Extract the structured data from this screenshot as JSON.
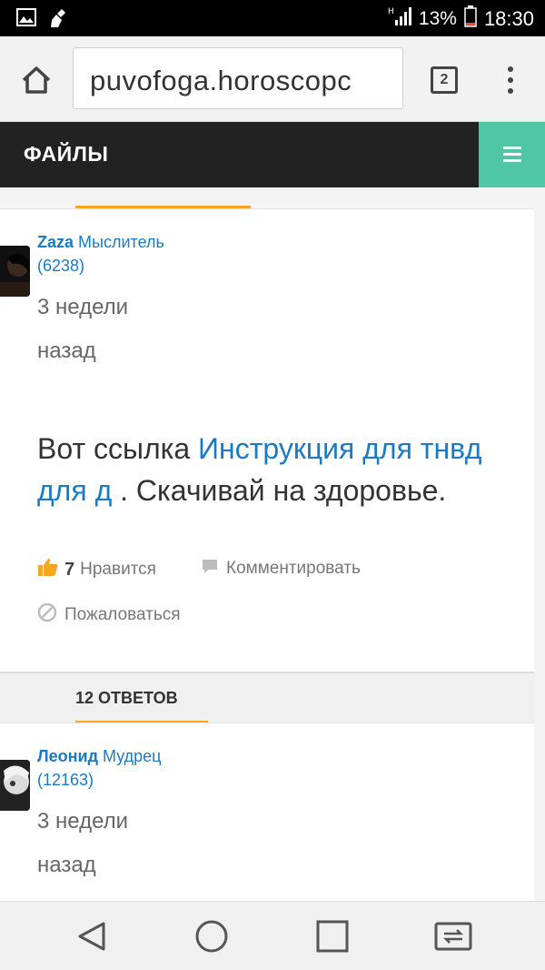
{
  "status_bar": {
    "signal_label": "H",
    "battery": "13%",
    "time": "18:30"
  },
  "browser": {
    "url": "puvofoga.horoscopc",
    "tab_count": "2"
  },
  "site": {
    "title": "ФАЙЛЫ"
  },
  "answer": {
    "user_name": "Zaza",
    "user_rank": "Мыслитель",
    "user_score": "(6238)",
    "time_line1": "3 недели",
    "time_line2": "назад",
    "text_before": "Вот ссылка ",
    "link_text": "Инструкция для тнвд для д",
    "text_after": " . Скачивай на здоровье.",
    "like_count": "7",
    "like_label": "Нравится",
    "comment_label": "Комментировать",
    "report_label": "Пожаловаться"
  },
  "answers_section": {
    "label": "12 ОТВЕТОВ"
  },
  "reply": {
    "user_name": "Леонид",
    "user_rank": "Мудрец",
    "user_score": "(12163)",
    "time_line1": "3 недели",
    "time_line2": "назад"
  },
  "colors": {
    "accent_orange": "#f5a623",
    "link_blue": "#1a7bc4",
    "menu_green": "#4fc7a5",
    "header_dark": "#222222"
  },
  "icons": [
    "image-icon",
    "cleaner-icon",
    "signal-icon",
    "battery-icon",
    "home-icon",
    "tabs-icon",
    "more-vert-icon",
    "hamburger-icon",
    "thumbs-up-icon",
    "comment-icon",
    "report-icon",
    "back-icon",
    "home-circle-icon",
    "recents-icon",
    "switch-icon"
  ]
}
